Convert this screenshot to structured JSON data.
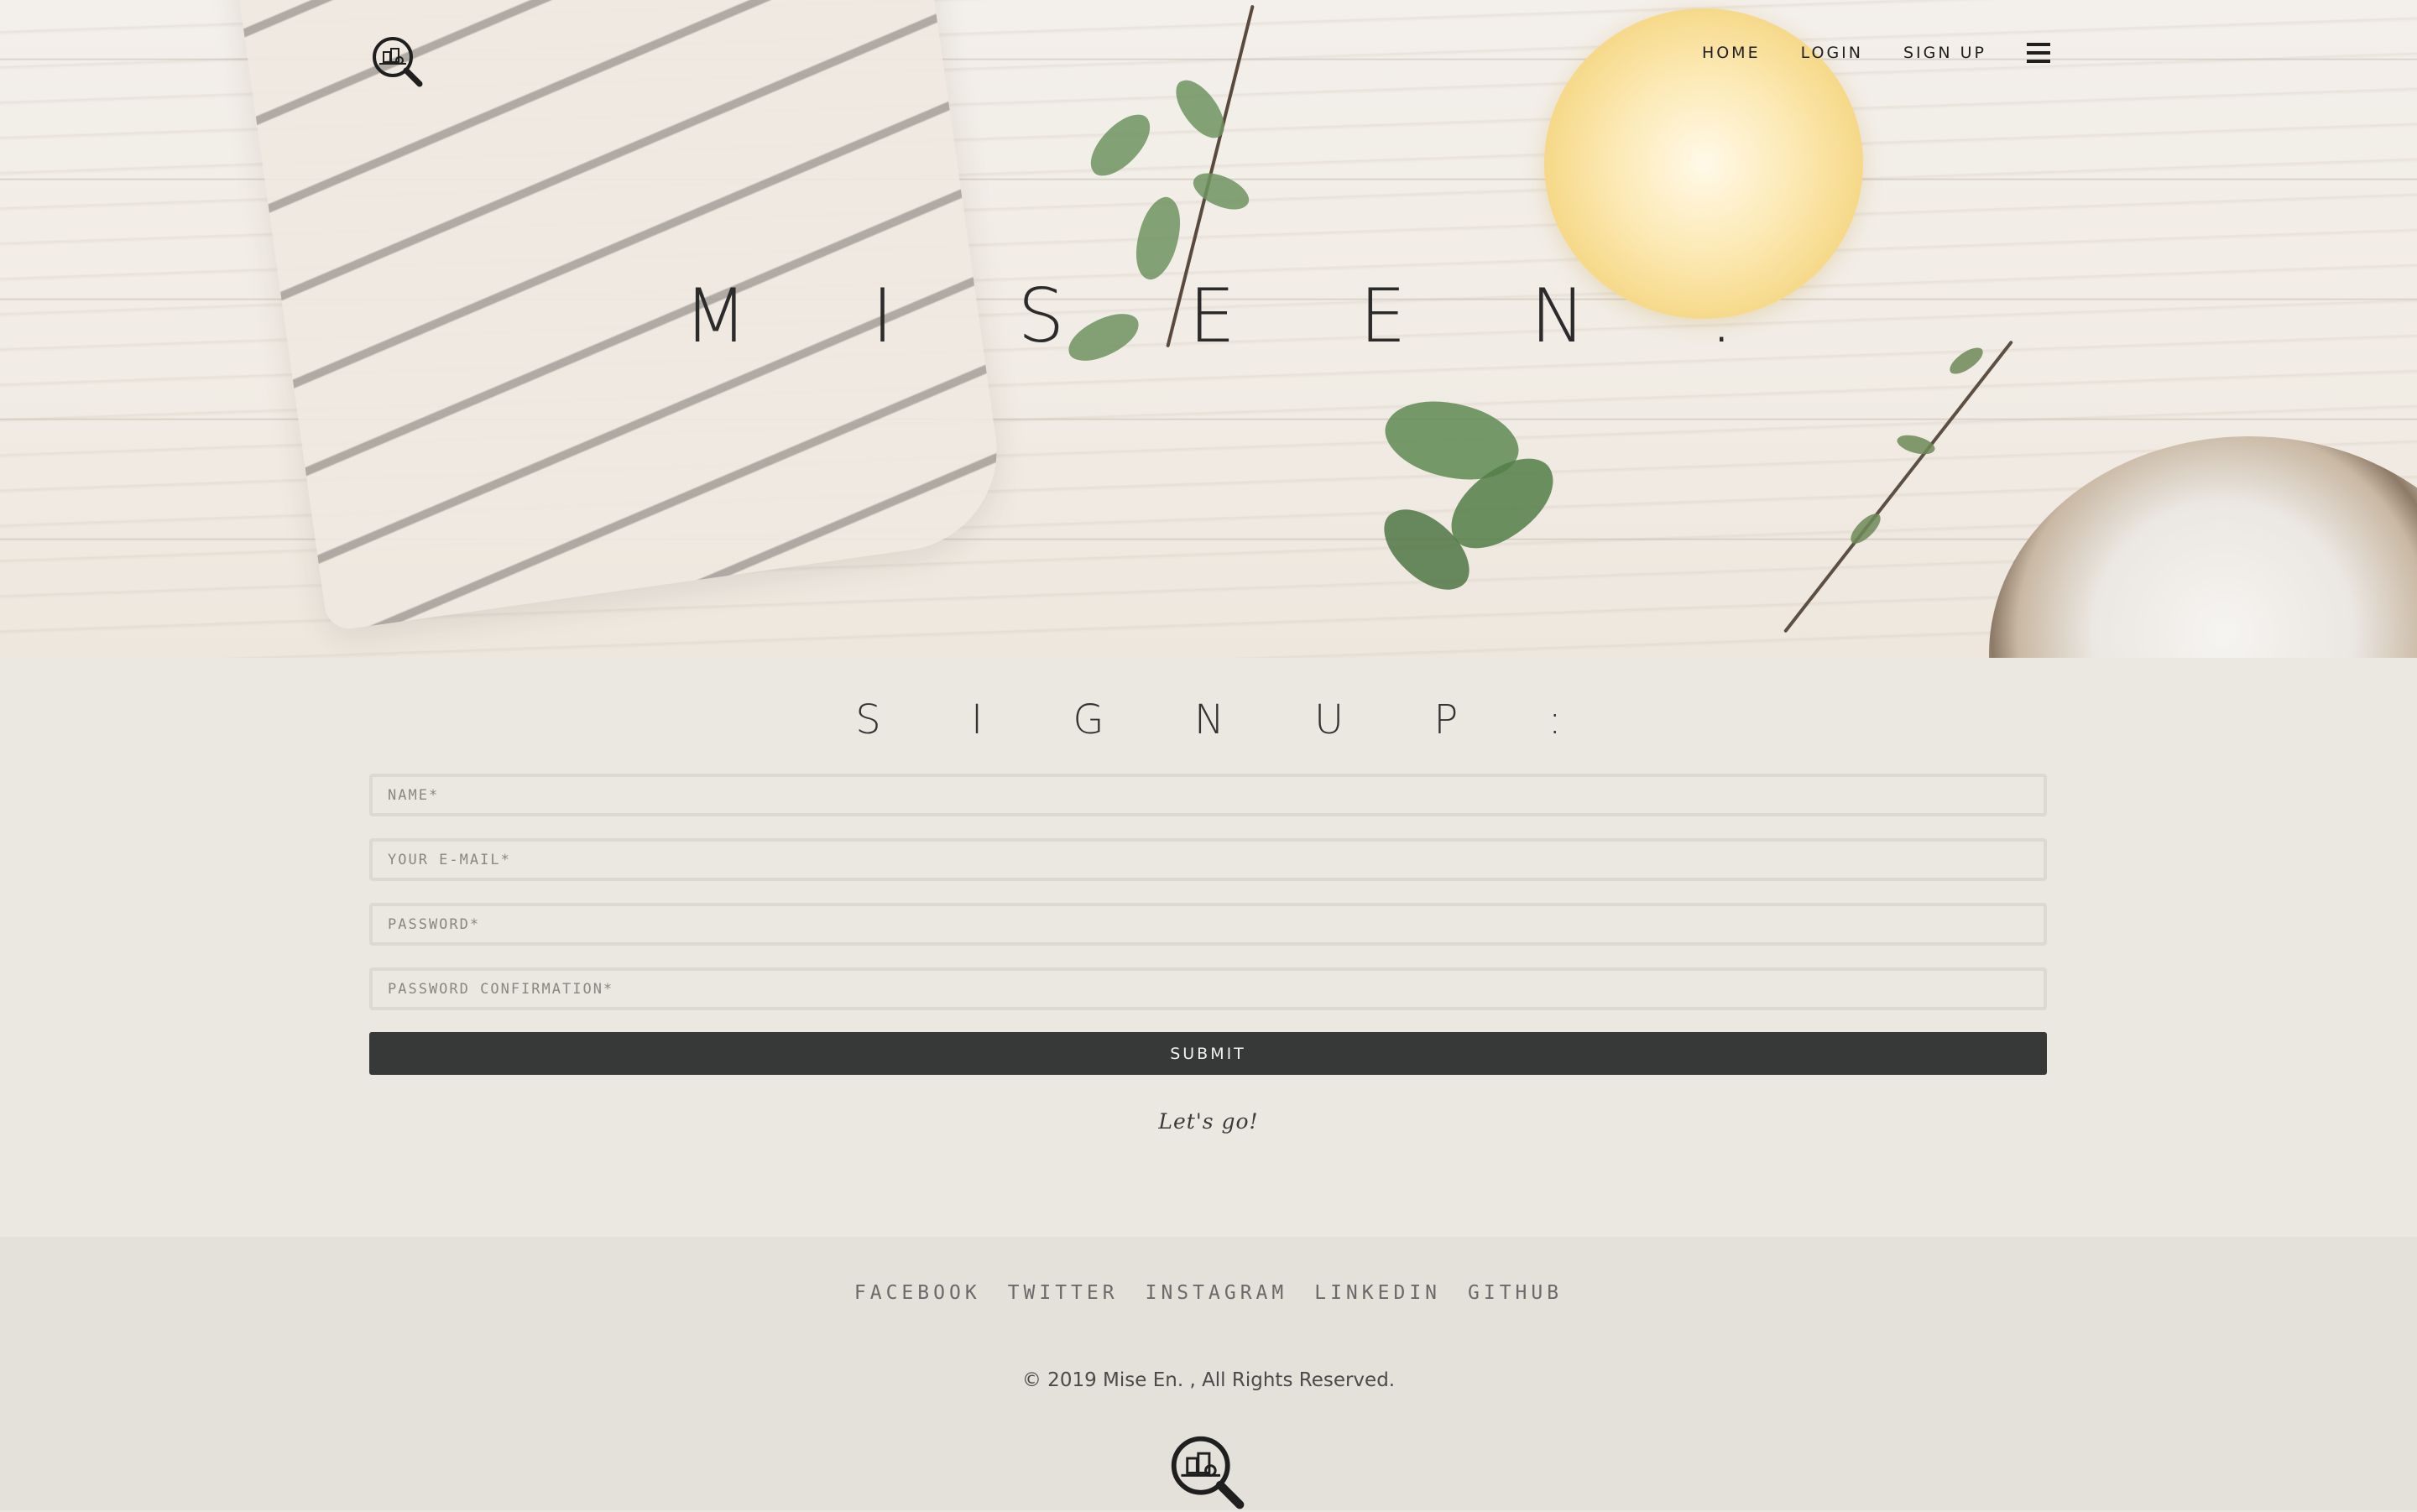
{
  "brand": {
    "title": "M I S E   E N .",
    "logo_icon": "magnifier-pantry-logo-icon"
  },
  "nav": {
    "home": "HOME",
    "login": "LOGIN",
    "signup": "SIGN UP",
    "menu_icon": "hamburger-menu-icon"
  },
  "signup": {
    "heading": "S I G N   U P :",
    "fields": {
      "name_placeholder": "NAME*",
      "email_placeholder": "YOUR E-MAIL*",
      "password_placeholder": "PASSWORD*",
      "password_confirm_placeholder": "PASSWORD CONFIRMATION*"
    },
    "submit_label": "SUBMIT",
    "tagline": "Let's go!"
  },
  "footer": {
    "social": [
      "FACEBOOK",
      "TWITTER",
      "INSTAGRAM",
      "LINKEDIN",
      "GITHUB"
    ],
    "copyright": "© 2019 Mise En. , All Rights Reserved."
  },
  "colors": {
    "page_bg": "#ebe7e1",
    "footer_bg": "#e4e1db",
    "button_bg": "#373939",
    "text_dark": "#2b2b2b"
  }
}
